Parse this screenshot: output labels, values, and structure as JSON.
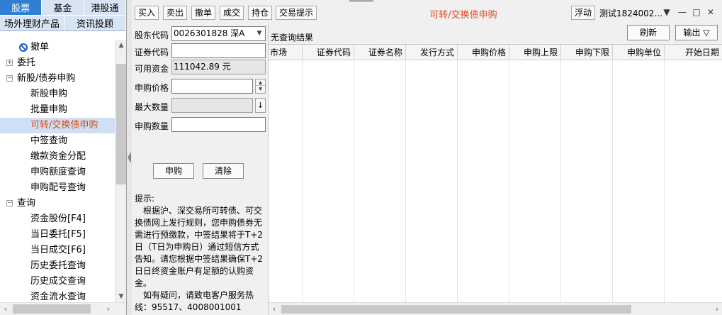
{
  "nav": {
    "tabs_row1": [
      "股票",
      "基金",
      "港股通"
    ],
    "tabs_row2": [
      "场外理财产品",
      "资讯投顾"
    ],
    "tree": [
      {
        "label": "撤单",
        "level": "cancel"
      },
      {
        "label": "委托",
        "level": "l0",
        "expander": "+"
      },
      {
        "label": "新股/债券申购",
        "level": "l0",
        "expander": "−"
      },
      {
        "label": "新股申购",
        "level": "l1"
      },
      {
        "label": "批量申购",
        "level": "l1"
      },
      {
        "label": "可转/交换债申购",
        "level": "l1",
        "selected": true
      },
      {
        "label": "中签查询",
        "level": "l1"
      },
      {
        "label": "缴款资金分配",
        "level": "l1"
      },
      {
        "label": "申购额度查询",
        "level": "l1"
      },
      {
        "label": "申购配号查询",
        "level": "l1"
      },
      {
        "label": "查询",
        "level": "l0",
        "expander": "−"
      },
      {
        "label": "资金股份[F4]",
        "level": "l1"
      },
      {
        "label": "当日委托[F5]",
        "level": "l1"
      },
      {
        "label": "当日成交[F6]",
        "level": "l1"
      },
      {
        "label": "历史委托查询",
        "level": "l1"
      },
      {
        "label": "历史成交查询",
        "level": "l1"
      },
      {
        "label": "资金流水查询",
        "level": "l1"
      }
    ]
  },
  "toolbar": {
    "buttons": [
      "买入",
      "卖出",
      "撤单",
      "成交",
      "持仓",
      "交易提示"
    ],
    "title": "可转/交换债申购",
    "float_label": "浮动",
    "user": "测试1824002...",
    "controls": [
      "▼",
      "—",
      "□",
      "✕"
    ]
  },
  "form": {
    "shareholder_label": "股东代码",
    "shareholder_value": "0026301828 深A",
    "code_label": "证券代码",
    "code_value": "",
    "funds_label": "可用资金",
    "funds_value": "111042.89 元",
    "price_label": "申购价格",
    "price_value": "",
    "max_label": "最大数量",
    "max_value": "",
    "qty_label": "申购数量",
    "qty_value": "",
    "submit_label": "申购",
    "clear_label": "清除",
    "tips_title": "提示:",
    "tips_para1": "根据沪、深交易所可转债、可交换债网上发行规则，您申购债券无需进行预缴款，中签结果将于T+2日（T日为申购日）通过短信方式告知。请您根据中签结果确保T+2日日终资金账户有足额的认购资金。",
    "tips_para2": "如有疑问，请致电客户服务热线：95517、4008001001"
  },
  "results": {
    "status": "无查询结果",
    "refresh_label": "刷新",
    "export_label": "输出 ▽",
    "columns": [
      "市场",
      "证券代码",
      "证券名称",
      "发行方式",
      "申购价格",
      "申购上限",
      "申购下限",
      "申购单位",
      "开始日期"
    ]
  }
}
